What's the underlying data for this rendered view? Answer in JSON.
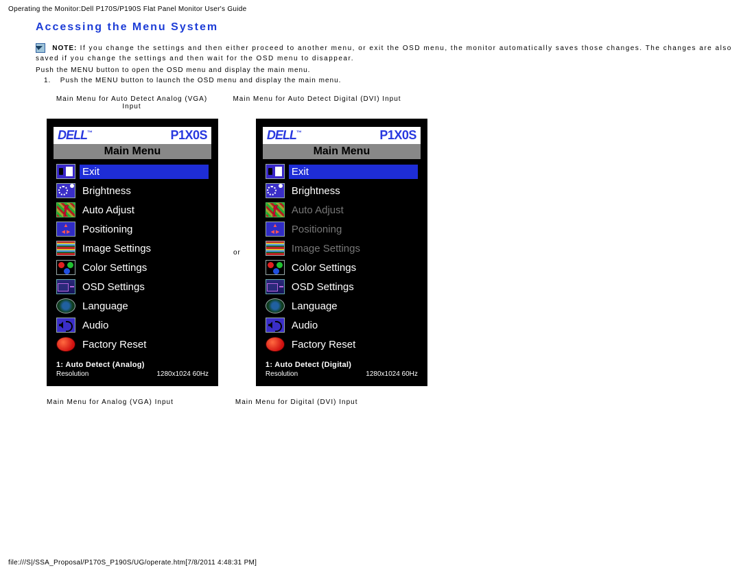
{
  "page_header": "Operating the Monitor:Dell P170S/P190S Flat Panel Monitor User's Guide",
  "section_title": "Accessing the Menu System",
  "note_label": "NOTE:",
  "note_text": "If you change the settings and then either proceed to another menu, or exit the OSD menu, the monitor automatically saves those changes. The changes are also saved if you change the settings and then wait for the OSD menu to disappear.",
  "push_line": "Push the MENU button to open the OSD menu and display the main menu.",
  "step_num": "1.",
  "step_text": "Push the MENU button to launch the OSD menu and display the main menu.",
  "caption1": "Main Menu for Auto Detect Analog (VGA) Input",
  "caption2": "Main Menu for Auto Detect Digital (DVI) Input",
  "or": "or",
  "bottom_caption1": "Main Menu for Analog (VGA) Input",
  "bottom_caption2": "Main Menu for Digital (DVI) Input",
  "osd": {
    "brand": "DELL",
    "tm": "™",
    "model": "P1X0S",
    "main_menu": "Main Menu",
    "resolution_label": "Resolution",
    "resolution_value": "1280x1024  60Hz",
    "menu_items": [
      {
        "label": "Exit",
        "icon": "ico-exit",
        "selected": true,
        "disabled": false
      },
      {
        "label": "Brightness",
        "icon": "ico-bright",
        "selected": false,
        "disabled": false
      },
      {
        "label": "Auto Adjust",
        "icon": "ico-auto",
        "selected": false,
        "disabled": false
      },
      {
        "label": "Positioning",
        "icon": "ico-pos",
        "selected": false,
        "disabled": false
      },
      {
        "label": "Image Settings",
        "icon": "ico-img",
        "selected": false,
        "disabled": false
      },
      {
        "label": "Color Settings",
        "icon": "ico-color",
        "selected": false,
        "disabled": false
      },
      {
        "label": "OSD Settings",
        "icon": "ico-osd",
        "selected": false,
        "disabled": false
      },
      {
        "label": "Language",
        "icon": "ico-lang",
        "selected": false,
        "disabled": false
      },
      {
        "label": "Audio",
        "icon": "ico-audio",
        "selected": false,
        "disabled": false
      },
      {
        "label": "Factory Reset",
        "icon": "ico-reset",
        "selected": false,
        "disabled": false
      }
    ],
    "disabled_dvi": [
      "Auto Adjust",
      "Positioning",
      "Image Settings"
    ]
  },
  "status1_analog": "1: Auto Detect (Analog)",
  "status1_digital": "1: Auto Detect (Digital)",
  "footer": "file:///S|/SSA_Proposal/P170S_P190S/UG/operate.htm[7/8/2011 4:48:31 PM]"
}
